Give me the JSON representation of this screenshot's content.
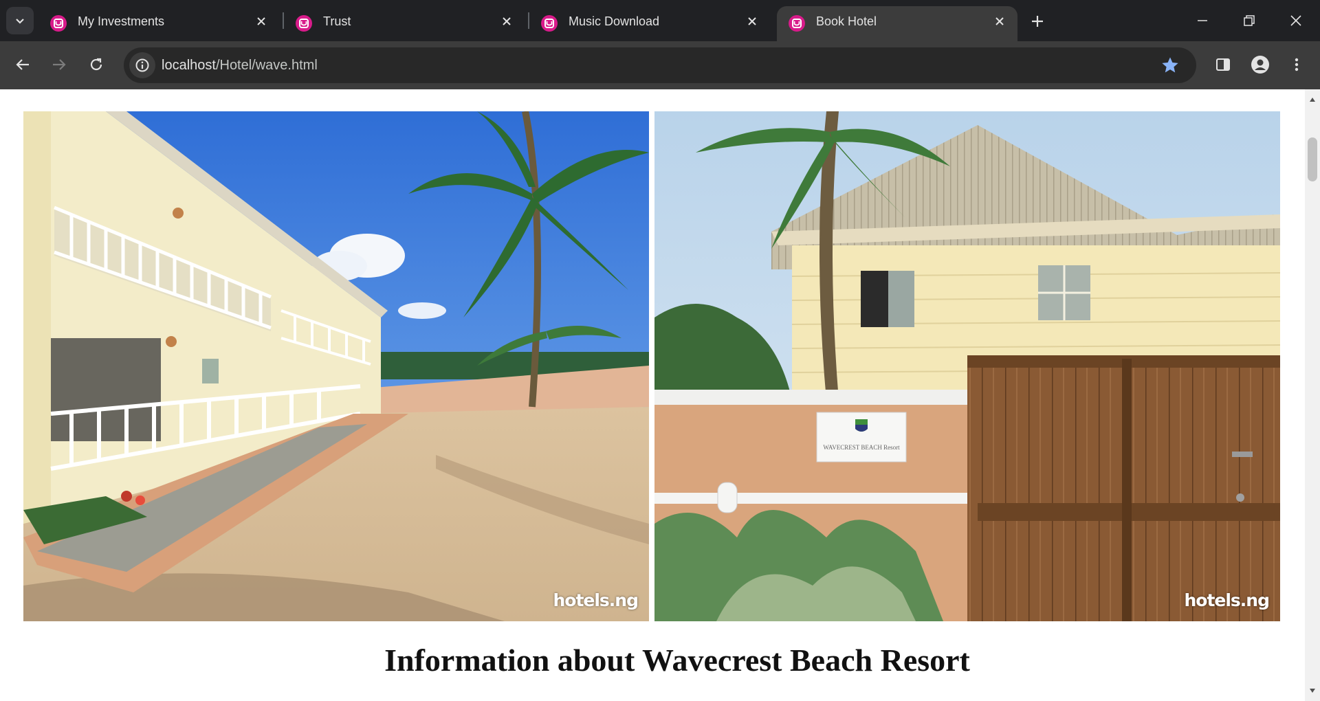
{
  "browser": {
    "tabs": [
      {
        "title": "My Investments",
        "active": false
      },
      {
        "title": "Trust",
        "active": false
      },
      {
        "title": "Music Download",
        "active": false
      },
      {
        "title": "Book Hotel",
        "active": true
      }
    ],
    "url_host": "localhost",
    "url_path": "/Hotel/wave.html",
    "accent_color": "#d81b8a",
    "bookmark_star_color": "#8ab4f8"
  },
  "page": {
    "photos": [
      {
        "alt": "Wavecrest Beach Resort building with balconies and sandy courtyard",
        "watermark": "hotels.ng"
      },
      {
        "alt": "Wavecrest Beach Resort entrance wall with sign and wooden gate",
        "watermark": "hotels.ng"
      }
    ],
    "gate_sign": "WAVECREST BEACH Resort",
    "heading": "Information about Wavecrest Beach Resort"
  }
}
